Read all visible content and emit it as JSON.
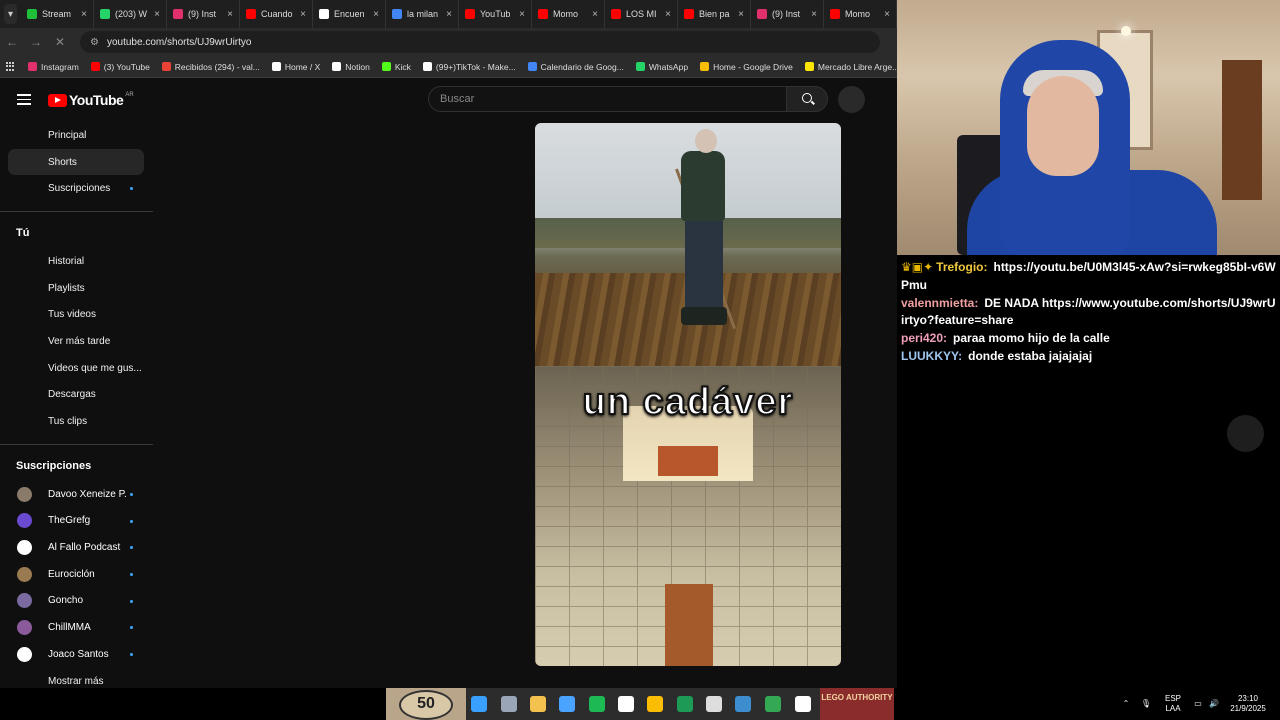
{
  "tabs": [
    {
      "label": "Stream",
      "color": "#1fbf3a"
    },
    {
      "label": "(203) W",
      "color": "#25d366"
    },
    {
      "label": "(9) Inst",
      "color": "#e1306c"
    },
    {
      "label": "Cuando",
      "color": "#ff0000"
    },
    {
      "label": "Encuen",
      "color": "#ffffff"
    },
    {
      "label": "la milan",
      "color": "#4285f4"
    },
    {
      "label": "YouTub",
      "color": "#ff0000"
    },
    {
      "label": "Momo",
      "color": "#ff0000"
    },
    {
      "label": "LOS MI",
      "color": "#ff0000"
    },
    {
      "label": "Bien pa",
      "color": "#ff0000"
    },
    {
      "label": "(9) Inst",
      "color": "#e1306c"
    },
    {
      "label": "Momo",
      "color": "#ff0000"
    }
  ],
  "address": {
    "url": "youtube.com/shorts/UJ9wrUirtyo"
  },
  "bookmarks": [
    {
      "label": "Instagram",
      "color": "#e1306c"
    },
    {
      "label": "(3) YouTube",
      "color": "#ff0000"
    },
    {
      "label": "Recibidos (294) - val...",
      "color": "#ea4335"
    },
    {
      "label": "Home / X",
      "color": "#ffffff"
    },
    {
      "label": "Notion",
      "color": "#ffffff"
    },
    {
      "label": "Kick",
      "color": "#53fc18"
    },
    {
      "label": "(99+)TikTok - Make...",
      "color": "#ffffff"
    },
    {
      "label": "Calendario de Goog...",
      "color": "#4285f4"
    },
    {
      "label": "WhatsApp",
      "color": "#25d366"
    },
    {
      "label": "Home - Google Drive",
      "color": "#fbbc04"
    },
    {
      "label": "Mercado Libre Arge...",
      "color": "#ffe600"
    }
  ],
  "youtube": {
    "logo_text": "YouTube",
    "country_code": "AR",
    "search_placeholder": "Buscar",
    "nav": [
      {
        "label": "Principal",
        "active": false,
        "dot": false
      },
      {
        "label": "Shorts",
        "active": true,
        "dot": false
      },
      {
        "label": "Suscripciones",
        "active": false,
        "dot": true
      }
    ],
    "you_heading": "Tú",
    "you_items": [
      {
        "label": "Historial"
      },
      {
        "label": "Playlists"
      },
      {
        "label": "Tus videos"
      },
      {
        "label": "Ver más tarde"
      },
      {
        "label": "Videos que me gus..."
      },
      {
        "label": "Descargas"
      },
      {
        "label": "Tus clips"
      }
    ],
    "subs_heading": "Suscripciones",
    "subs": [
      {
        "label": "Davoo Xeneize P...",
        "color": "#8a7a6a"
      },
      {
        "label": "TheGrefg",
        "color": "#6a4ad0"
      },
      {
        "label": "Al Fallo Podcast",
        "color": "#ffffff"
      },
      {
        "label": "Eurociclón",
        "color": "#9a7a50"
      },
      {
        "label": "Goncho",
        "color": "#7a6aa0"
      },
      {
        "label": "ChillMMA",
        "color": "#8a5a9a"
      },
      {
        "label": "Joaco Santos",
        "color": "#ffffff"
      }
    ],
    "show_more": "Mostrar más",
    "short_caption": "un cadáver"
  },
  "chat": {
    "messages": [
      {
        "user": "Trefogio:",
        "user_color": "#f0c83c",
        "badge": "♛▣✦",
        "text": "https://youtu.be/U0M3l45-xAw?si=rwkeg85bI-v6WPmu"
      },
      {
        "user": "valennmietta:",
        "user_color": "#f0a0a0",
        "badge": "",
        "text": "DE NADA https://www.youtube.com/shorts/UJ9wrUirtyo?feature=share"
      },
      {
        "user": "peri420:",
        "user_color": "#f0a0b8",
        "badge": "",
        "text": "paraa momo hijo de la calle"
      },
      {
        "user": "LUUKKYY:",
        "user_color": "#a0c8f0",
        "badge": "",
        "text": "donde estaba jajajajaj"
      }
    ]
  },
  "taskbar": {
    "left_badge": "50",
    "right_badge": "LEGO AUTHORITY",
    "lang": "ESP",
    "region": "LAA",
    "time": "23:10",
    "date": "21/9/2025",
    "icons": [
      {
        "name": "windows-start-icon",
        "color": "#3aa0ff"
      },
      {
        "name": "steam-icon",
        "color": "#9aa6b8"
      },
      {
        "name": "file-explorer-icon",
        "color": "#f2c14e"
      },
      {
        "name": "store-icon",
        "color": "#4aa3ff"
      },
      {
        "name": "spotify-icon",
        "color": "#1db954"
      },
      {
        "name": "notepad-icon",
        "color": "#ffffff"
      },
      {
        "name": "chrome-icon",
        "color": "#fbbc04"
      },
      {
        "name": "excel-icon",
        "color": "#1d9b55"
      },
      {
        "name": "epic-games-icon",
        "color": "#dddddd"
      },
      {
        "name": "steam-client-icon",
        "color": "#3e8ecf"
      },
      {
        "name": "chrome-profile-icon",
        "color": "#34a853"
      },
      {
        "name": "tiktok-icon",
        "color": "#ffffff"
      }
    ]
  }
}
